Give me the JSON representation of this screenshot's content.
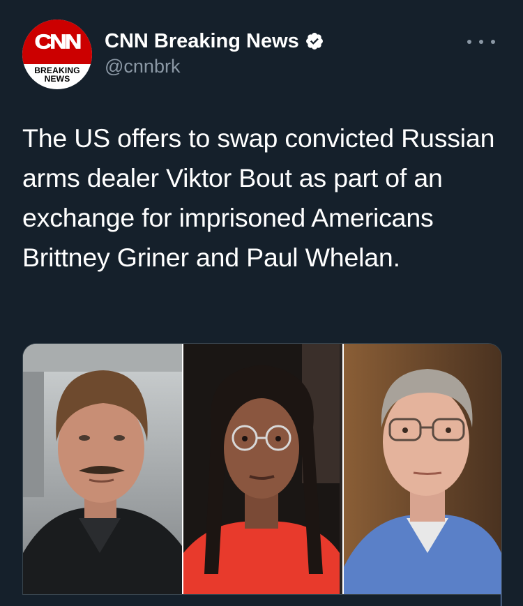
{
  "account": {
    "display_name": "CNN Breaking News",
    "handle": "@cnnbrk",
    "avatar": {
      "logo_text": "CNN",
      "badge_line1": "BREAKING",
      "badge_line2": "NEWS"
    },
    "verified_icon": "verified-badge-icon",
    "more_icon": "more-options-icon"
  },
  "tweet": {
    "text": "The US offers to swap convicted Russian arms dealer Viktor Bout as part of an exchange for imprisoned Americans Brittney Griner and Paul Whelan."
  },
  "media": {
    "photos": [
      {
        "name": "photo-viktor-bout"
      },
      {
        "name": "photo-brittney-griner"
      },
      {
        "name": "photo-paul-whelan"
      }
    ]
  },
  "colors": {
    "background": "#15202b",
    "text_primary": "#ffffff",
    "text_secondary": "#8b98a5",
    "cnn_red": "#cc0000",
    "verified": "#ffffff"
  }
}
